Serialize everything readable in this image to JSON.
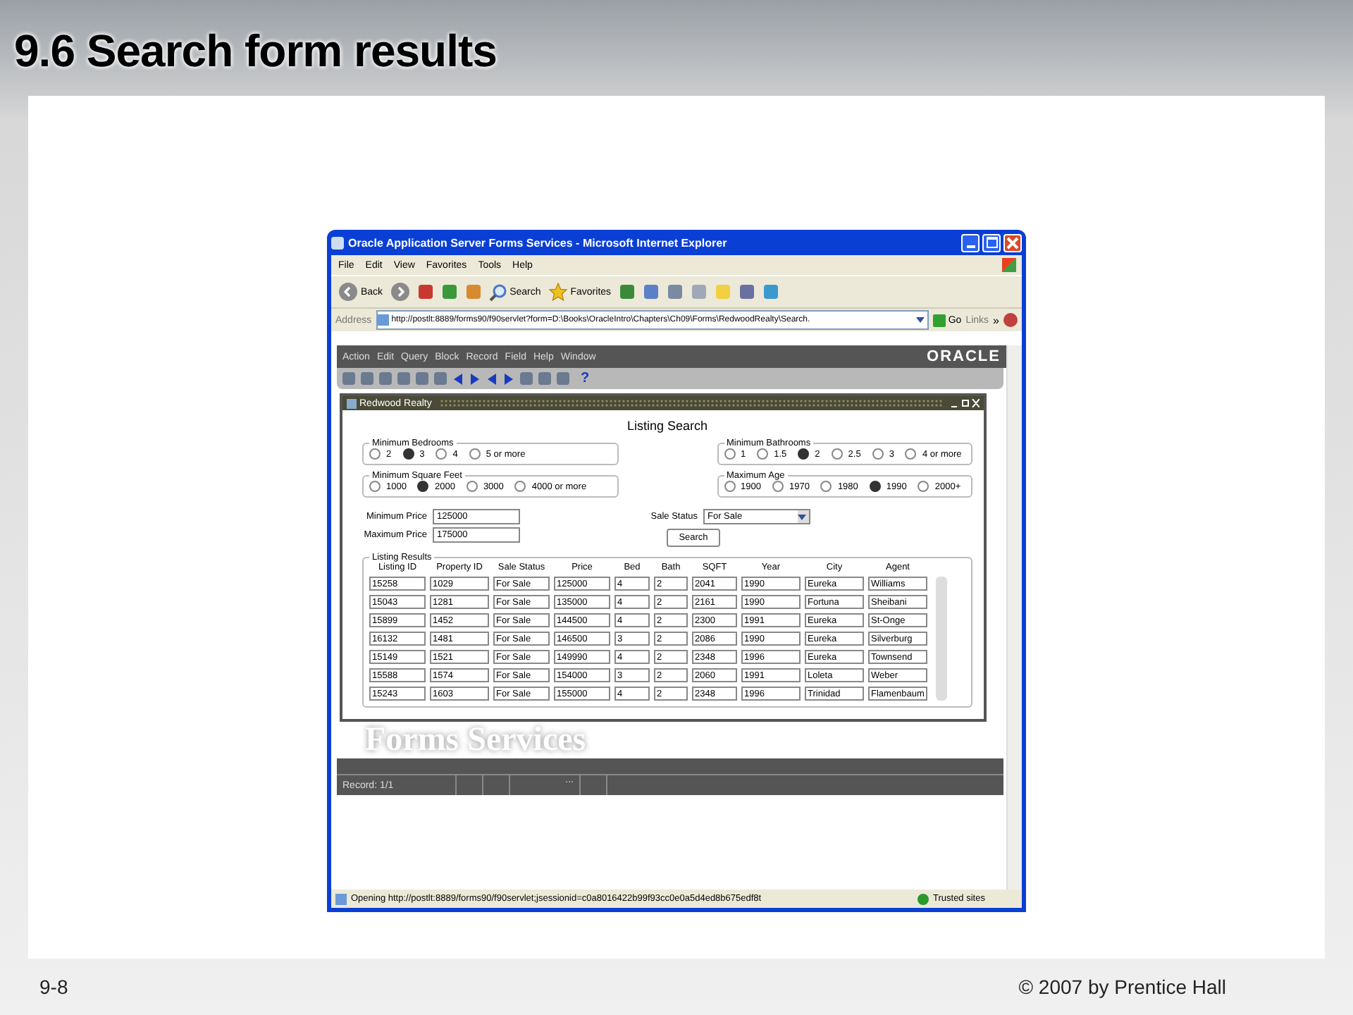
{
  "slide": {
    "title": "9.6 Search form results",
    "footer_left": "9-8",
    "footer_right": "© 2007 by Prentice Hall"
  },
  "browser": {
    "title": "Oracle Application Server Forms Services - Microsoft Internet Explorer",
    "menu": [
      "File",
      "Edit",
      "View",
      "Favorites",
      "Tools",
      "Help"
    ],
    "toolbar": [
      {
        "kind": "back",
        "label": "Back"
      },
      {
        "kind": "forward"
      },
      {
        "kind": "stop"
      },
      {
        "kind": "refresh"
      },
      {
        "kind": "home"
      },
      {
        "kind": "search",
        "label": "Search"
      },
      {
        "kind": "favorites",
        "label": "Favorites"
      },
      {
        "kind": "history"
      },
      {
        "kind": "mail"
      },
      {
        "kind": "print"
      },
      {
        "kind": "edit"
      },
      {
        "kind": "note"
      },
      {
        "kind": "research"
      },
      {
        "kind": "messenger"
      }
    ],
    "address": {
      "label": "Address",
      "url": "http://postlt:8889/forms90/f90servlet?form=D:\\Books\\OracleIntro\\Chapters\\Ch09\\Forms\\RedwoodRealty\\Search."
    },
    "go": "Go",
    "links": "Links",
    "links_more": "»",
    "status": {
      "text": "Opening http://postlt:8889/forms90/f90servlet;jsessionid=c0a8016422b99f93cc0e0a5d4ed8b675edf8t",
      "zone": "Trusted sites"
    }
  },
  "oracle": {
    "menu": [
      "Action",
      "Edit",
      "Query",
      "Block",
      "Record",
      "Field",
      "Help",
      "Window"
    ],
    "brand": "ORACLE",
    "help": "?",
    "form": {
      "title": "Redwood Realty",
      "heading": "Listing Search",
      "groups": [
        {
          "label": "Minimum Bedrooms",
          "options": [
            {
              "label": "2",
              "selected": false
            },
            {
              "label": "3",
              "selected": true
            },
            {
              "label": "4",
              "selected": false
            },
            {
              "label": "5 or more",
              "selected": false
            }
          ]
        },
        {
          "label": "Minimum Bathrooms",
          "options": [
            {
              "label": "1",
              "selected": false
            },
            {
              "label": "1.5",
              "selected": false
            },
            {
              "label": "2",
              "selected": true
            },
            {
              "label": "2.5",
              "selected": false
            },
            {
              "label": "3",
              "selected": false
            },
            {
              "label": "4 or more",
              "selected": false
            }
          ]
        },
        {
          "label": "Minimum Square Feet",
          "options": [
            {
              "label": "1000",
              "selected": false
            },
            {
              "label": "2000",
              "selected": true
            },
            {
              "label": "3000",
              "selected": false
            },
            {
              "label": "4000 or more",
              "selected": false
            }
          ]
        },
        {
          "label": "Maximum Age",
          "options": [
            {
              "label": "1900",
              "selected": false
            },
            {
              "label": "1970",
              "selected": false
            },
            {
              "label": "1980",
              "selected": false
            },
            {
              "label": "1990",
              "selected": true
            },
            {
              "label": "2000+",
              "selected": false
            }
          ]
        }
      ],
      "min_price": {
        "label": "Minimum Price",
        "value": "125000"
      },
      "max_price": {
        "label": "Maximum Price",
        "value": "175000"
      },
      "sale_status": {
        "label": "Sale Status",
        "value": "For Sale"
      },
      "search_button": "Search",
      "results": {
        "label": "Listing Results",
        "columns": [
          "Listing ID",
          "Property ID",
          "Sale Status",
          "Price",
          "Bed",
          "Bath",
          "SQFT",
          "Year",
          "City",
          "Agent"
        ],
        "rows": [
          [
            "15258",
            "1029",
            "For Sale",
            "125000",
            "4",
            "2",
            "2041",
            "1990",
            "Eureka",
            "Williams"
          ],
          [
            "15043",
            "1281",
            "For Sale",
            "135000",
            "4",
            "2",
            "2161",
            "1990",
            "Fortuna",
            "Sheibani"
          ],
          [
            "15899",
            "1452",
            "For Sale",
            "144500",
            "4",
            "2",
            "2300",
            "1991",
            "Eureka",
            "St-Onge"
          ],
          [
            "16132",
            "1481",
            "For Sale",
            "146500",
            "3",
            "2",
            "2086",
            "1990",
            "Eureka",
            "Silverburg"
          ],
          [
            "15149",
            "1521",
            "For Sale",
            "149990",
            "4",
            "2",
            "2348",
            "1996",
            "Eureka",
            "Townsend"
          ],
          [
            "15588",
            "1574",
            "For Sale",
            "154000",
            "3",
            "2",
            "2060",
            "1991",
            "Loleta",
            "Weber"
          ],
          [
            "15243",
            "1603",
            "For Sale",
            "155000",
            "4",
            "2",
            "2348",
            "1996",
            "Trinidad",
            "Flamenbaum"
          ]
        ]
      }
    },
    "background_text": "Forms Services",
    "status": {
      "record": "Record: 1/1",
      "ellipsis": "..."
    }
  }
}
